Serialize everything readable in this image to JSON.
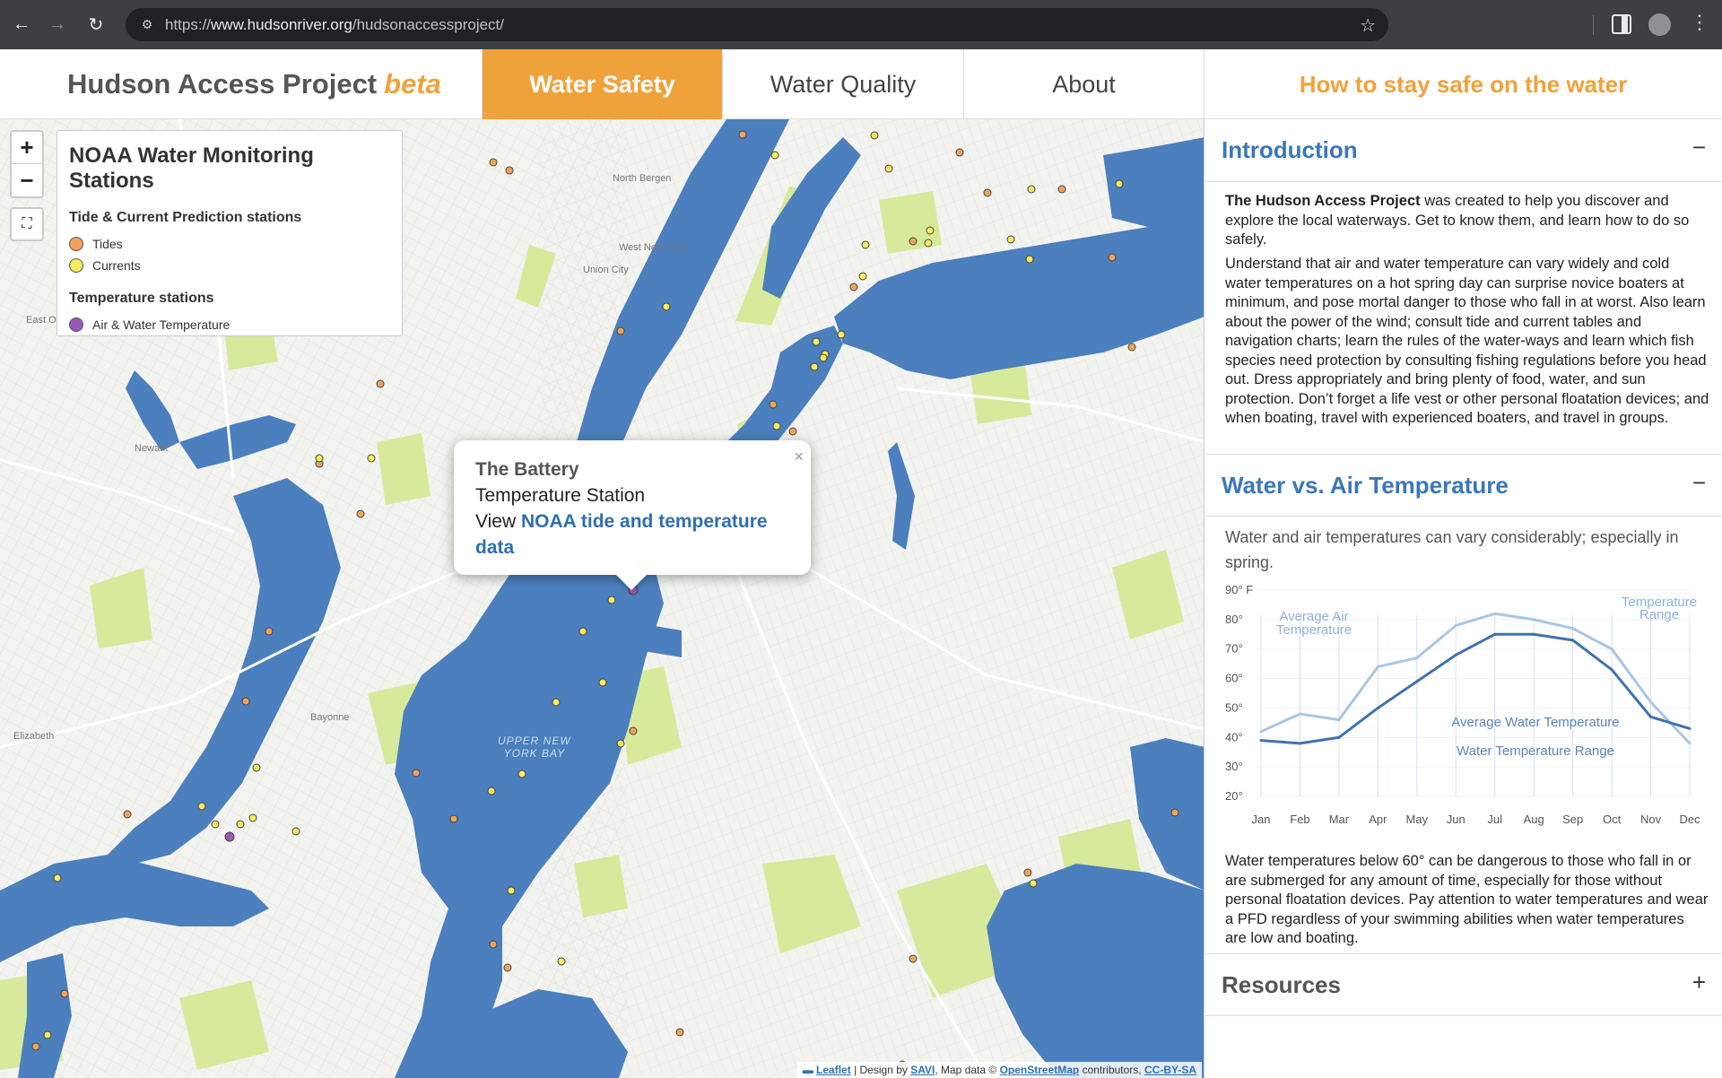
{
  "browser": {
    "url_prefix": "https://",
    "url_host": "www.hudsonriver.org",
    "url_path": "/hudsonaccessproject/"
  },
  "header": {
    "brand": "Hudson Access Project",
    "brand_suffix": "beta",
    "tabs": [
      {
        "label": "Water Safety",
        "active": true
      },
      {
        "label": "Water Quality",
        "active": false
      },
      {
        "label": "About",
        "active": false
      }
    ],
    "panel_title": "How to stay safe on the water"
  },
  "map": {
    "legend": {
      "title": "NOAA Water Monitoring Stations",
      "section1": "Tide & Current Prediction stations",
      "items1": [
        {
          "label": "Tides",
          "color": "#f0a25a"
        },
        {
          "label": "Currents",
          "color": "#f5ec5f"
        }
      ],
      "section2": "Temperature stations",
      "items2": [
        {
          "label": "Air & Water Temperature",
          "color": "#9b59b6"
        }
      ]
    },
    "zoom_in": "+",
    "zoom_out": "−",
    "labels": {
      "north_bergen": "North Bergen",
      "west_new_york": "West New York",
      "union_city": "Union City",
      "newark": "Newark",
      "bayonne": "Bayonne",
      "elizabeth": "Elizabeth",
      "east_or": "East Or",
      "bay_line1": "UPPER NEW",
      "bay_line2": "YORK BAY"
    },
    "popup": {
      "title": "The Battery",
      "subtitle": "Temperature Station",
      "view_prefix": "View",
      "link_text": "NOAA tide and temperature data",
      "close": "×"
    },
    "attribution": {
      "leaflet": "Leaflet",
      "design_by": "| Design by",
      "savi": "SAVI",
      "map_data": ", Map data ©",
      "osm": "OpenStreetMap",
      "contributors": "contributors,",
      "license": "CC-BY-SA"
    }
  },
  "panel": {
    "intro": {
      "heading": "Introduction",
      "toggle": "−",
      "p1_bold": "The Hudson Access Project",
      "p1_rest": " was created to help you discover and explore the local waterways. Get to know them, and learn how to do so safely.",
      "p2": "Understand that air and water temperature can vary widely and cold water temperatures on a hot spring day can surprise novice boaters at minimum, and pose mortal danger to those who fall in at worst. Also learn about the power of the wind; consult tide and current tables and navigation charts; learn the rules of the water-ways and learn which fish species need protection by consulting fishing regulations before you head out. Dress appropriately and bring plenty of food, water, and sun protection. Don’t forget a life vest or other personal floatation devices; and when boating, travel with experienced boaters, and travel in groups."
    },
    "temp": {
      "heading": "Water vs. Air Temperature",
      "toggle": "−",
      "intro": "Water and air temperatures can vary considerably; especially in spring.",
      "outro": "Water temperatures below 60° can be dangerous to those who fall in or are submerged for any amount of time, especially for those without personal floatation devices. Pay attention to water temperatures and wear a PFD regardless of your swimming abilities when water temperatures are low and boating."
    },
    "resources": {
      "heading": "Resources",
      "toggle": "+"
    }
  },
  "chart_data": {
    "type": "line",
    "categories": [
      "Jan",
      "Feb",
      "Mar",
      "Apr",
      "May",
      "Jun",
      "Jul",
      "Aug",
      "Sep",
      "Oct",
      "Nov",
      "Dec"
    ],
    "y_ticks": [
      "90° F",
      "80°",
      "70°",
      "60°",
      "50°",
      "40°",
      "30°",
      "20°"
    ],
    "ylim": [
      20,
      90
    ],
    "series": [
      {
        "name": "Average Air Temperature",
        "color": "#a9c6e3",
        "values": [
          42,
          48,
          46,
          64,
          67,
          78,
          82,
          80,
          77,
          70,
          52,
          38
        ]
      },
      {
        "name": "Average Water Temperature",
        "color": "#3f73ad",
        "values": [
          39,
          38,
          40,
          50,
          59,
          68,
          75,
          75,
          73,
          63,
          47,
          43
        ]
      }
    ],
    "annotations": {
      "air_avg": [
        "Average Air",
        "Temperature"
      ],
      "air_range": [
        "Temperature",
        "Range"
      ],
      "water_avg": "Average Water Temperature",
      "water_range": "Water Temperature Range"
    }
  }
}
